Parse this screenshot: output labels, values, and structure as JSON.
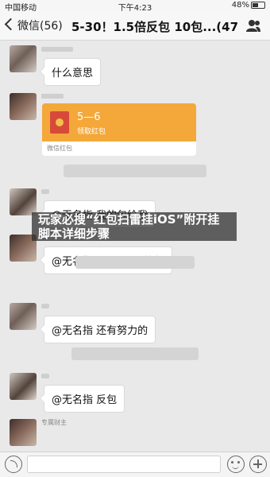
{
  "status": {
    "carrier": "中国移动",
    "time": "下午4:23",
    "battery": "48%"
  },
  "nav": {
    "back_label": "微信(56)",
    "title": "5-30！1.5倍反包 10包...(47)"
  },
  "messages": [
    {
      "type": "text",
      "text": "什么意思"
    },
    {
      "type": "red_packet",
      "amount": "5—6",
      "label": "领取红包",
      "footer": "微信红包"
    },
    {
      "type": "text",
      "text": "@无名指 我的包给我"
    },
    {
      "type": "text",
      "text": "@无名指 反两个7.5的包"
    },
    {
      "type": "text",
      "text": "@无名指 还有努力的"
    },
    {
      "type": "text",
      "text": "@无名指 反包"
    }
  ],
  "last_sender_partial": "专属财主",
  "banner": "玩家必搜“红包扫雷挂iOS”附开挂脚本详细步骤"
}
